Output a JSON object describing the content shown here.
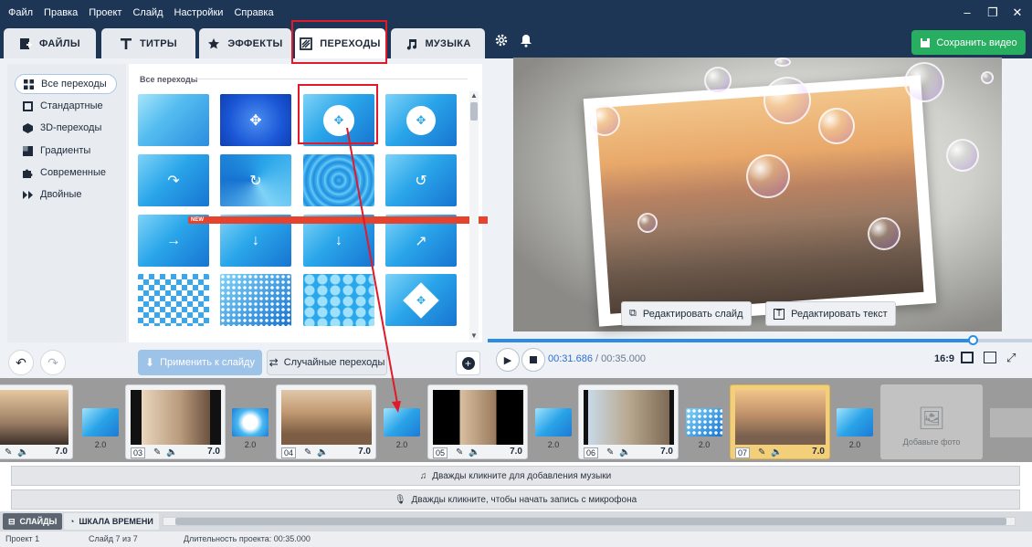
{
  "menu": [
    "Файл",
    "Правка",
    "Проект",
    "Слайд",
    "Настройки",
    "Справка"
  ],
  "tabs": [
    {
      "label": "ФАЙЛЫ",
      "icon": "file-add-icon"
    },
    {
      "label": "ТИТРЫ",
      "icon": "text-t-icon"
    },
    {
      "label": "ЭФФЕКТЫ",
      "icon": "star-effects-icon"
    },
    {
      "label": "ПЕРЕХОДЫ",
      "icon": "transitions-icon",
      "active": true
    },
    {
      "label": "МУЗЫКА",
      "icon": "music-note-icon"
    }
  ],
  "save_button": "Сохранить видео",
  "categories": [
    {
      "label": "Все переходы",
      "active": true
    },
    {
      "label": "Стандартные"
    },
    {
      "label": "3D-переходы"
    },
    {
      "label": "Градиенты"
    },
    {
      "label": "Современные"
    },
    {
      "label": "Двойные"
    }
  ],
  "grid_title": "Все переходы",
  "new_badge": "NEW",
  "apply_button": "Применить к слайду",
  "random_button": "Случайные переходы",
  "edit_slide_button": "Редактировать слайд",
  "edit_text_button": "Редактировать текст",
  "time_current": "00:31.686",
  "time_total": "/ 00:35.000",
  "aspect_ratio": "16:9",
  "slides": [
    {
      "num": "",
      "dur": "7.0"
    },
    {
      "num": "03",
      "dur": "7.0"
    },
    {
      "num": "04",
      "dur": "7.0"
    },
    {
      "num": "05",
      "dur": "7.0"
    },
    {
      "num": "06",
      "dur": "7.0"
    },
    {
      "num": "07",
      "dur": "7.0",
      "selected": true
    }
  ],
  "transition_durations": [
    "2.0",
    "2.0",
    "2.0",
    "2.0",
    "2.0",
    "2.0"
  ],
  "add_photo": "Добавьте фото",
  "music_track": "Дважды кликните для добавления музыки",
  "mic_track": "Дважды кликните, чтобы начать запись с микрофона",
  "bottom_tabs": {
    "slides": "СЛАЙДЫ",
    "timeline": "ШКАЛА ВРЕМЕНИ"
  },
  "status": {
    "project": "Проект 1",
    "slide": "Слайд 7 из 7",
    "duration": "Длительность проекта: 00:35.000"
  },
  "colors": {
    "header": "#1d3656",
    "accent": "#2c8de3",
    "save": "#27ae60",
    "highlight": "#e0192b"
  }
}
